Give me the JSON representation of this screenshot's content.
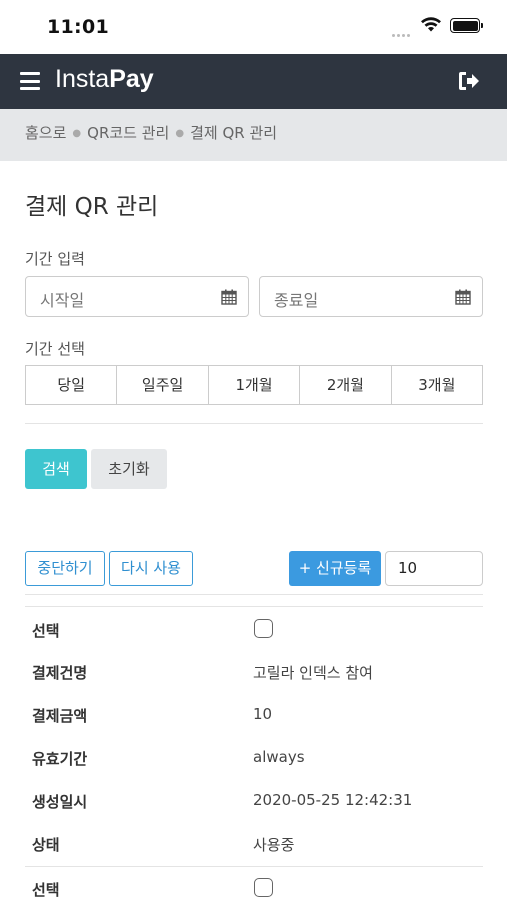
{
  "status_bar": {
    "time": "11:01"
  },
  "app": {
    "brand_light": "Insta",
    "brand_bold": "Pay"
  },
  "breadcrumb": [
    "홈으로",
    "QR코드 관리",
    "결제 QR 관리"
  ],
  "page_title": "결제 QR 관리",
  "filters": {
    "period_input_label": "기간 입력",
    "start_placeholder": "시작일",
    "end_placeholder": "종료일",
    "period_select_label": "기간 선택",
    "periods": [
      "당일",
      "일주일",
      "1개월",
      "2개월",
      "3개월"
    ],
    "search_label": "검색",
    "reset_label": "초기화"
  },
  "actions": {
    "stop_label": "중단하기",
    "reuse_label": "다시 사용",
    "new_label": "+ 신규등록",
    "page_size": "10"
  },
  "record": {
    "select_label": "선택",
    "name_label": "결제건명",
    "name_value": "고릴라 인덱스 참여",
    "amount_label": "결제금액",
    "amount_value": "10",
    "validity_label": "유효기간",
    "validity_value": "always",
    "created_label": "생성일시",
    "created_value": "2020-05-25 12:42:31",
    "status_label": "상태",
    "status_value": "사용중"
  },
  "record2": {
    "select_label": "선택"
  },
  "colors": {
    "navbar": "#2e3540",
    "search_button": "#3ec5cf",
    "primary": "#3b9ae0"
  }
}
